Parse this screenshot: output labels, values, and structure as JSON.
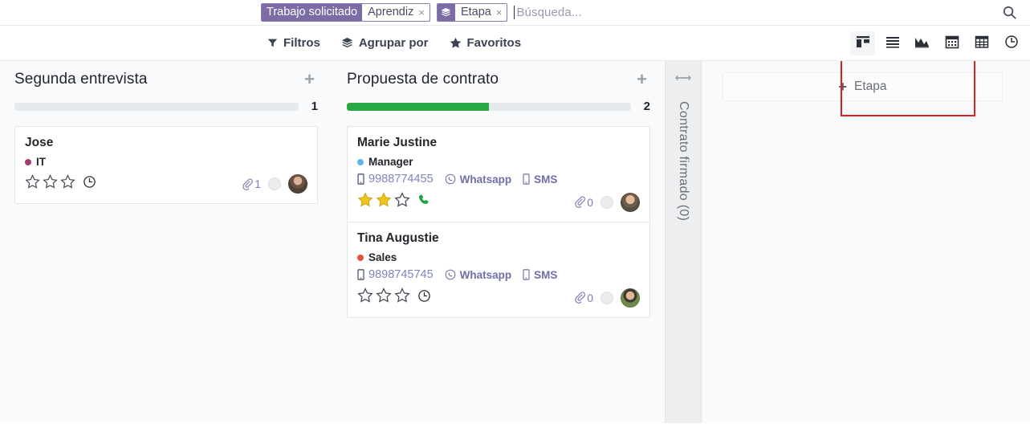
{
  "search": {
    "facets": [
      {
        "label": "Trabajo solicitado",
        "value": "Aprendiz",
        "close": "×",
        "icon": null
      },
      {
        "label": null,
        "value": "Etapa",
        "close": "×",
        "icon": "layers-icon"
      }
    ],
    "placeholder": "Búsqueda...",
    "query": "",
    "search_icon": "search-icon"
  },
  "toolbar": {
    "filters_label": "Filtros",
    "groupby_label": "Agrupar por",
    "favorites_label": "Favoritos",
    "filters_icon": "funnel-icon",
    "groupby_icon": "layers-icon",
    "favorites_icon": "star-icon",
    "views": [
      {
        "name": "kanban-view",
        "icon": "kanban-icon",
        "active": true
      },
      {
        "name": "list-view",
        "icon": "list-icon",
        "active": false
      },
      {
        "name": "graph-view",
        "icon": "area-chart-icon",
        "active": false
      },
      {
        "name": "calendar-view",
        "icon": "calendar-icon",
        "active": false
      },
      {
        "name": "pivot-view",
        "icon": "grid-icon",
        "active": false
      },
      {
        "name": "activity-view",
        "icon": "clock-icon",
        "active": false
      }
    ]
  },
  "kanban": {
    "columns": [
      {
        "title": "Segunda entrevista",
        "count": "1",
        "progress_percent": 0,
        "add_icon": "plus-icon",
        "cards": [
          {
            "name": "Jose",
            "tag": "IT",
            "tag_color": "#a33b6e",
            "phone": null,
            "whatsapp": null,
            "sms": null,
            "stars_filled": 0,
            "stars_total": 3,
            "trailing_icon": "clock-icon",
            "attachments": "1",
            "kanban_dot_color": "#ebecee",
            "avatar": "avatar-jose"
          }
        ]
      },
      {
        "title": "Propuesta de contrato",
        "count": "2",
        "progress_percent": 50,
        "add_icon": "plus-icon",
        "cards": [
          {
            "name": "Marie Justine",
            "tag": "Manager",
            "tag_color": "#5bb8e8",
            "phone": "9988774455",
            "whatsapp": "Whatsapp",
            "sms": "SMS",
            "stars_filled": 2,
            "stars_total": 3,
            "trailing_icon": "phone-handset-icon",
            "attachments": "0",
            "kanban_dot_color": "#ebecee",
            "avatar": "avatar-marie"
          },
          {
            "name": "Tina Augustie",
            "tag": "Sales",
            "tag_color": "#e8503a",
            "phone": "9898745745",
            "whatsapp": "Whatsapp",
            "sms": "SMS",
            "stars_filled": 0,
            "stars_total": 3,
            "trailing_icon": "clock-icon",
            "attachments": "0",
            "kanban_dot_color": "#ebecee",
            "avatar": "avatar-tina"
          }
        ]
      }
    ],
    "folded_column": {
      "title": "Contrato firmado (0)",
      "expand_icon": "expand-horizontal-icon"
    },
    "add_column": {
      "label": "Etapa",
      "plus": "+",
      "highlight_color": "#e02020"
    }
  },
  "colors": {
    "facet_purple": "#7d6ba6",
    "progress_green": "#28a745",
    "link_purple": "#7c7bb1",
    "star_gold": "#f0c419",
    "phone_green": "#1aa446"
  }
}
